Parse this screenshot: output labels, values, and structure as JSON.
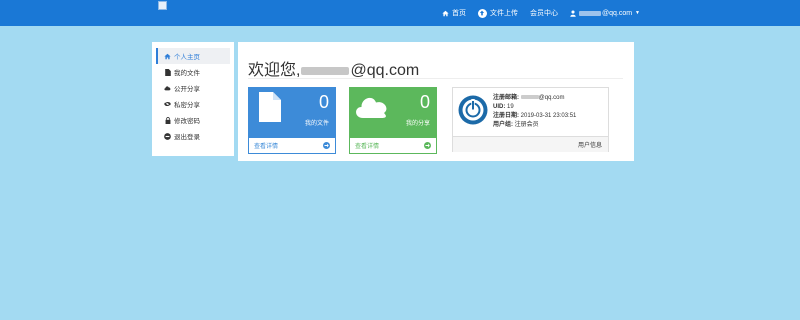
{
  "navbar": {
    "items": [
      {
        "label": "首页",
        "icon": "home-icon"
      },
      {
        "label": "文件上传",
        "icon": "upload-icon"
      },
      {
        "label": "会员中心"
      },
      {
        "label": "@qq.com",
        "icon": "user-icon"
      }
    ]
  },
  "sidebar": {
    "items": [
      {
        "label": "个人主页",
        "icon": "home-icon",
        "active": true
      },
      {
        "label": "我的文件",
        "icon": "file-icon"
      },
      {
        "label": "公开分享",
        "icon": "cloud-icon"
      },
      {
        "label": "私密分享",
        "icon": "eye-slash-icon"
      },
      {
        "label": "修改密码",
        "icon": "lock-icon"
      },
      {
        "label": "退出登录",
        "icon": "minus-circle-icon"
      }
    ]
  },
  "main": {
    "welcome_prefix": "欢迎您,",
    "welcome_suffix": "@qq.com",
    "cards": [
      {
        "count": "0",
        "sub": "我的文件",
        "link": "查看详情",
        "color": "#3d8bd8",
        "icon": "file-icon"
      },
      {
        "count": "0",
        "sub": "我的分享",
        "link": "查看详情",
        "color": "#5cb85c",
        "icon": "cloud-icon"
      }
    ],
    "user_card": {
      "email_label": "注册邮箱:",
      "email_suffix": "@qq.com",
      "uid_label": "UID:",
      "uid_value": "19",
      "date_label": "注册日期:",
      "date_value": "2019-03-31 23:03:51",
      "group_label": "用户组:",
      "group_value": "注册会员",
      "footer": "用户信息"
    }
  },
  "colors": {
    "navbar": "#1a78d6",
    "background": "#a3daf2",
    "primary": "#3d8bd8",
    "success": "#5cb85c"
  }
}
